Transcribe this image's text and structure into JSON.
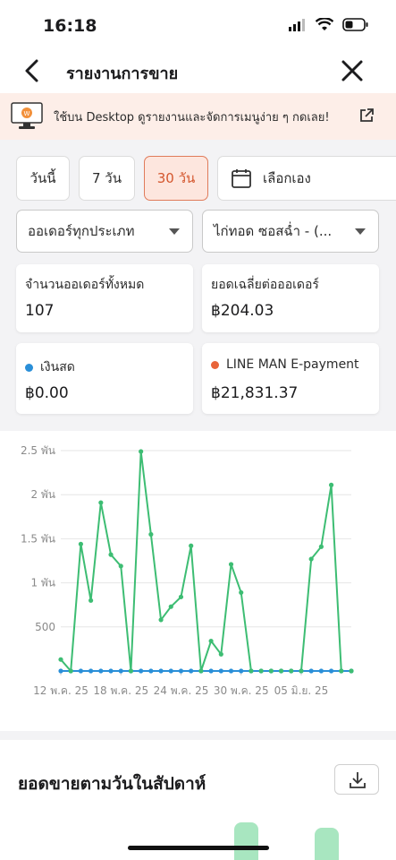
{
  "status": {
    "time": "16:18"
  },
  "nav": {
    "title": "รายงานการขาย"
  },
  "banner": {
    "text": "ใช้บน Desktop ดูรายงานและจัดการเมนูง่าย ๆ กดเลย!"
  },
  "filters": {
    "ranges": [
      "วันนี้",
      "7 วัน",
      "30 วัน"
    ],
    "selected_range": "30 วัน",
    "custom_label": "เลือกเอง",
    "order_type": "ออเดอร์ทุกประเภท",
    "store": "ไก่ทอด ซอสฉ่ำ - (..."
  },
  "summary": {
    "total_orders_label": "จำนวนออเดอร์ทั้งหมด",
    "total_orders_value": "107",
    "avg_label": "ยอดเฉลี่ยต่อออเดอร์",
    "avg_value": "฿204.03",
    "cash_label": "เงินสด",
    "cash_value": "฿0.00",
    "lineman_label": "LINE MAN E-payment",
    "lineman_value": "฿21,831.37"
  },
  "colors": {
    "cash": "#2a8fd8",
    "lineman": "#e8643a",
    "line": "#3dbd73",
    "accent": "#d4572e"
  },
  "chart_data": {
    "type": "line",
    "yticks": [
      "500",
      "1 พัน",
      "1.5 พัน",
      "2 พัน",
      "2.5 พัน"
    ],
    "ytick_values": [
      500,
      1000,
      1500,
      2000,
      2500
    ],
    "xticks": [
      "12 พ.ค. 25",
      "18 พ.ค. 25",
      "24 พ.ค. 25",
      "30 พ.ค. 25",
      "05 มิ.ย. 25"
    ],
    "xtick_index": [
      0,
      6,
      12,
      18,
      24
    ],
    "ylim": [
      0,
      2500
    ],
    "series": [
      {
        "values": [
          130,
          0,
          1440,
          800,
          1910,
          1320,
          1190,
          0,
          2490,
          1550,
          580,
          730,
          840,
          1420,
          0,
          340,
          190,
          1210,
          890,
          0,
          0,
          0,
          0,
          0,
          0,
          1270,
          1410,
          2110,
          0,
          0
        ],
        "color": "#3dbd73"
      },
      {
        "values": [
          0,
          0,
          0,
          0,
          0,
          0,
          0,
          0,
          0,
          0,
          0,
          0,
          0,
          0,
          0,
          0,
          0,
          0,
          0,
          0,
          0,
          0,
          0,
          0,
          0,
          0,
          0,
          0,
          0,
          0
        ],
        "color": "#2a8fd8"
      }
    ]
  },
  "weekly": {
    "title": "ยอดขายตามวันในสัปดาห์",
    "bar_color": "#a8e6c0"
  }
}
